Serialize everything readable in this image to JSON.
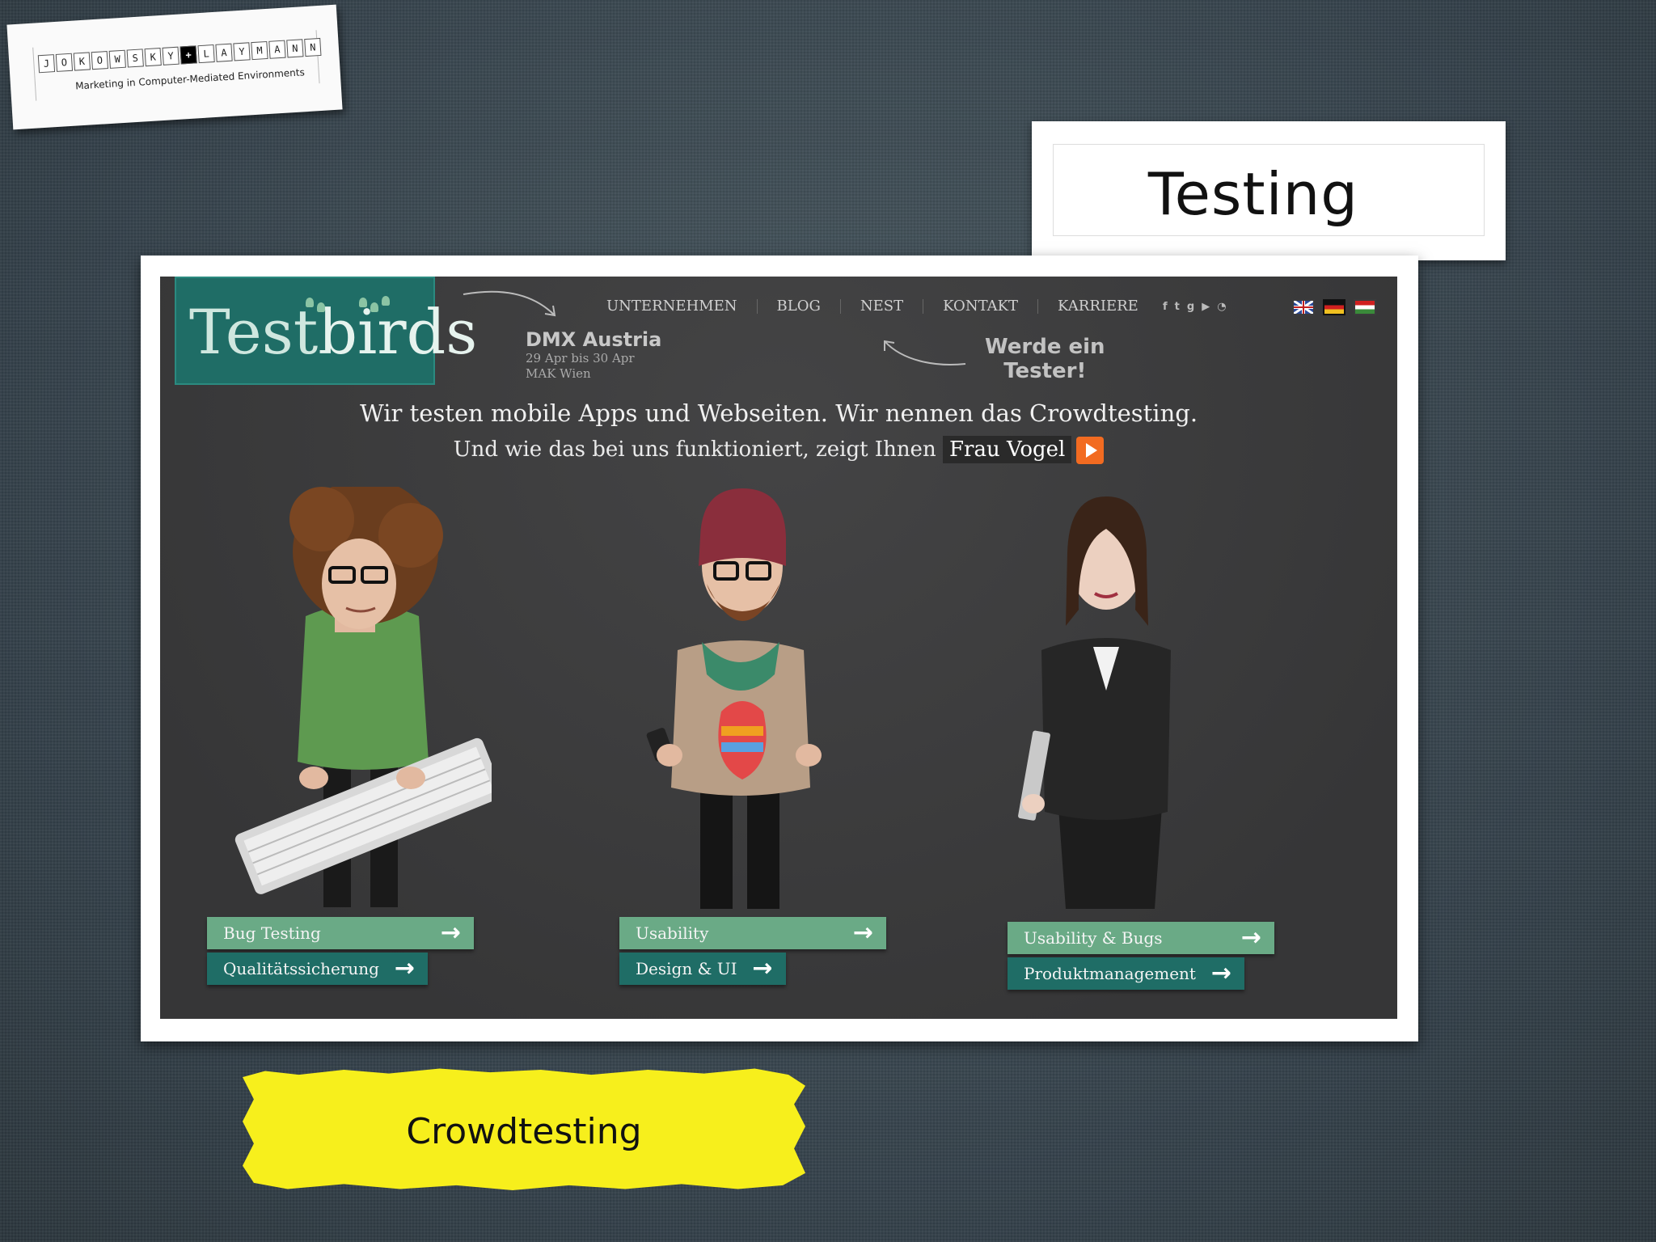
{
  "logo_card": {
    "letters": [
      "J",
      "O",
      "K",
      "O",
      "W",
      "S",
      "K",
      "Y",
      "+",
      "L",
      "A",
      "Y",
      "M",
      "A",
      "N",
      "N"
    ],
    "subtitle": "Marketing in Computer-Mediated Environments"
  },
  "slide_title": "Testing",
  "website": {
    "logo_text_a": "Test",
    "logo_text_b": "birds",
    "nav": [
      "UNTERNEHMEN",
      "BLOG",
      "NEST",
      "KONTAKT",
      "KARRIERE"
    ],
    "social_icons": [
      "facebook-icon",
      "twitter-icon",
      "googleplus-icon",
      "youtube-icon",
      "rss-icon"
    ],
    "flags": [
      {
        "name": "uk-flag-icon",
        "color": "#2a4a9a"
      },
      {
        "name": "de-flag-icon",
        "color": "#d89a10",
        "active": true
      },
      {
        "name": "hu-flag-icon",
        "color": "#3a8a3a"
      }
    ],
    "event": {
      "title": "DMX Austria",
      "dates": "29 Apr bis 30 Apr",
      "place": "MAK Wien"
    },
    "tester_cta_line1": "Werde ein",
    "tester_cta_line2": "Tester!",
    "headline": "Wir testen mobile Apps und Webseiten. Wir nennen das Crowdtesting.",
    "subline": "Und wie das bei uns funktioniert, zeigt Ihnen",
    "subline_link": "Frau Vogel",
    "personas": [
      {
        "name": "developer",
        "main_label": "Bug Testing",
        "sub_label": "Qualitätssicherung"
      },
      {
        "name": "designer",
        "main_label": "Usability",
        "sub_label": "Design & UI"
      },
      {
        "name": "manager",
        "main_label": "Usability & Bugs",
        "sub_label": "Produktmanagement"
      }
    ]
  },
  "caption": "Crowdtesting",
  "colors": {
    "accent_green": "#6aaa86",
    "dark_teal": "#1f6d66",
    "label_yellow": "#f7ef1c",
    "cta_orange": "#f26b21"
  }
}
